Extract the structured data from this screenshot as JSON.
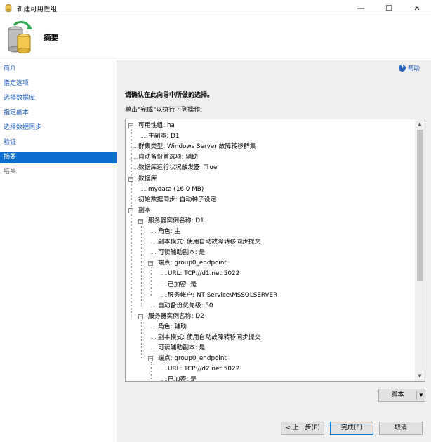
{
  "window": {
    "title": "新建可用性组",
    "minimize": "—",
    "maximize": "☐",
    "close": "✕"
  },
  "header": {
    "title": "摘要"
  },
  "sidebar": {
    "items": [
      {
        "label": "简介",
        "state": "link"
      },
      {
        "label": "指定选项",
        "state": "link"
      },
      {
        "label": "选择数据库",
        "state": "link"
      },
      {
        "label": "指定副本",
        "state": "link"
      },
      {
        "label": "选择数据同步",
        "state": "link"
      },
      {
        "label": "验证",
        "state": "link"
      },
      {
        "label": "摘要",
        "state": "active"
      },
      {
        "label": "结果",
        "state": "disabled"
      }
    ]
  },
  "main": {
    "help": "帮助",
    "confirm": "请确认在此向导中所做的选择。",
    "instruction": "单击\"完成\"以执行下列操作:"
  },
  "tree": [
    {
      "text": "可用性组: ha",
      "level": 0,
      "expander": "−"
    },
    {
      "text": "主副本: D1",
      "level": 1,
      "expander": ""
    },
    {
      "text": "群集类型: Windows Server 故障转移群集",
      "level": 0,
      "expander": ""
    },
    {
      "text": "自动备份首选项: 辅助",
      "level": 0,
      "expander": ""
    },
    {
      "text": "数据库运行状况触发器: True",
      "level": 0,
      "expander": ""
    },
    {
      "text": "数据库",
      "level": 0,
      "expander": "−"
    },
    {
      "text": "mydata (16.0 MB)",
      "level": 1,
      "expander": ""
    },
    {
      "text": "初始数据同步: 自动种子设定",
      "level": 0,
      "expander": ""
    },
    {
      "text": "副本",
      "level": 0,
      "expander": "−"
    },
    {
      "text": "服务器实例名称: D1",
      "level": 1,
      "expander": "−"
    },
    {
      "text": "角色: 主",
      "level": 2,
      "expander": ""
    },
    {
      "text": "副本模式: 使用自动故障转移同步提交",
      "level": 2,
      "expander": ""
    },
    {
      "text": "可读辅助副本: 是",
      "level": 2,
      "expander": ""
    },
    {
      "text": "端点: group0_endpoint",
      "level": 2,
      "expander": "−"
    },
    {
      "text": "URL: TCP://d1.net:5022",
      "level": 3,
      "expander": ""
    },
    {
      "text": "已加密: 是",
      "level": 3,
      "expander": ""
    },
    {
      "text": "服务帐户: NT Service\\MSSQLSERVER",
      "level": 3,
      "expander": ""
    },
    {
      "text": "自动备份优先级: 50",
      "level": 2,
      "expander": ""
    },
    {
      "text": "服务器实例名称: D2",
      "level": 1,
      "expander": "−"
    },
    {
      "text": "角色: 辅助",
      "level": 2,
      "expander": ""
    },
    {
      "text": "副本模式: 使用自动故障转移同步提交",
      "level": 2,
      "expander": ""
    },
    {
      "text": "可读辅助副本: 是",
      "level": 2,
      "expander": ""
    },
    {
      "text": "端点: group0_endpoint",
      "level": 2,
      "expander": "−"
    },
    {
      "text": "URL: TCP://d2.net:5022",
      "level": 3,
      "expander": ""
    },
    {
      "text": "已加密: 是",
      "level": 3,
      "expander": ""
    }
  ],
  "buttons": {
    "script": "脚本",
    "script_dropdown": "▼",
    "back": "< 上一步(P)",
    "finish": "完成(F)",
    "cancel": "取消"
  },
  "scrollbar": {
    "up": "▲",
    "down": "▼"
  },
  "colors": {
    "accent": "#0a6fd0",
    "link": "#2060c0",
    "panel": "#f0f0f0"
  }
}
